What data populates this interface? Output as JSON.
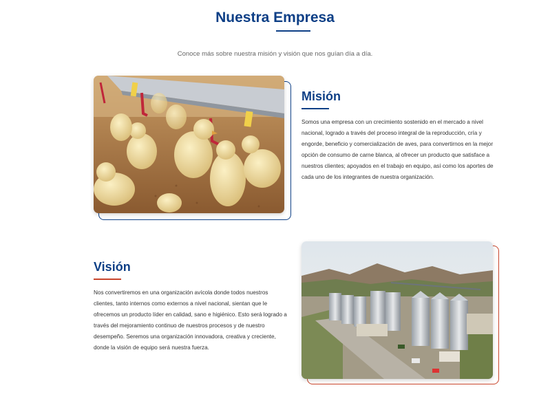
{
  "header": {
    "title": "Nuestra Empresa",
    "subtitle": "Conoce más sobre nuestra misión y visión que nos guían día a día."
  },
  "mision": {
    "title": "Misión",
    "text": "Somos una empresa con un crecimiento sostenido en el mercado a nivel nacional, logrado a través del proceso integral de la reproducción, cría y engorde, beneficio y comercialización de aves, para convertirnos en la mejor opción de consumo de carne blanca, al ofrecer un producto que satisface a nuestros clientes; apoyados en el trabajo en equipo, así como los aportes de cada uno de los integrantes de nuestra organización."
  },
  "vision": {
    "title": "Visión",
    "text": "Nos convertiremos en una organización avícola donde todos nuestros clientes, tanto internos como externos a nivel nacional, sientan que le ofrecemos un producto líder en calidad, sano e higiénico. Esto será logrado a través del mejoramiento continuo de nuestros procesos y de nuestro desempeño. Seremos una organización innovadora, creativa y creciente, donde la visión de equipo será nuestra fuerza."
  },
  "colors": {
    "primary": "#0d3f86",
    "accent": "#c8452b"
  }
}
